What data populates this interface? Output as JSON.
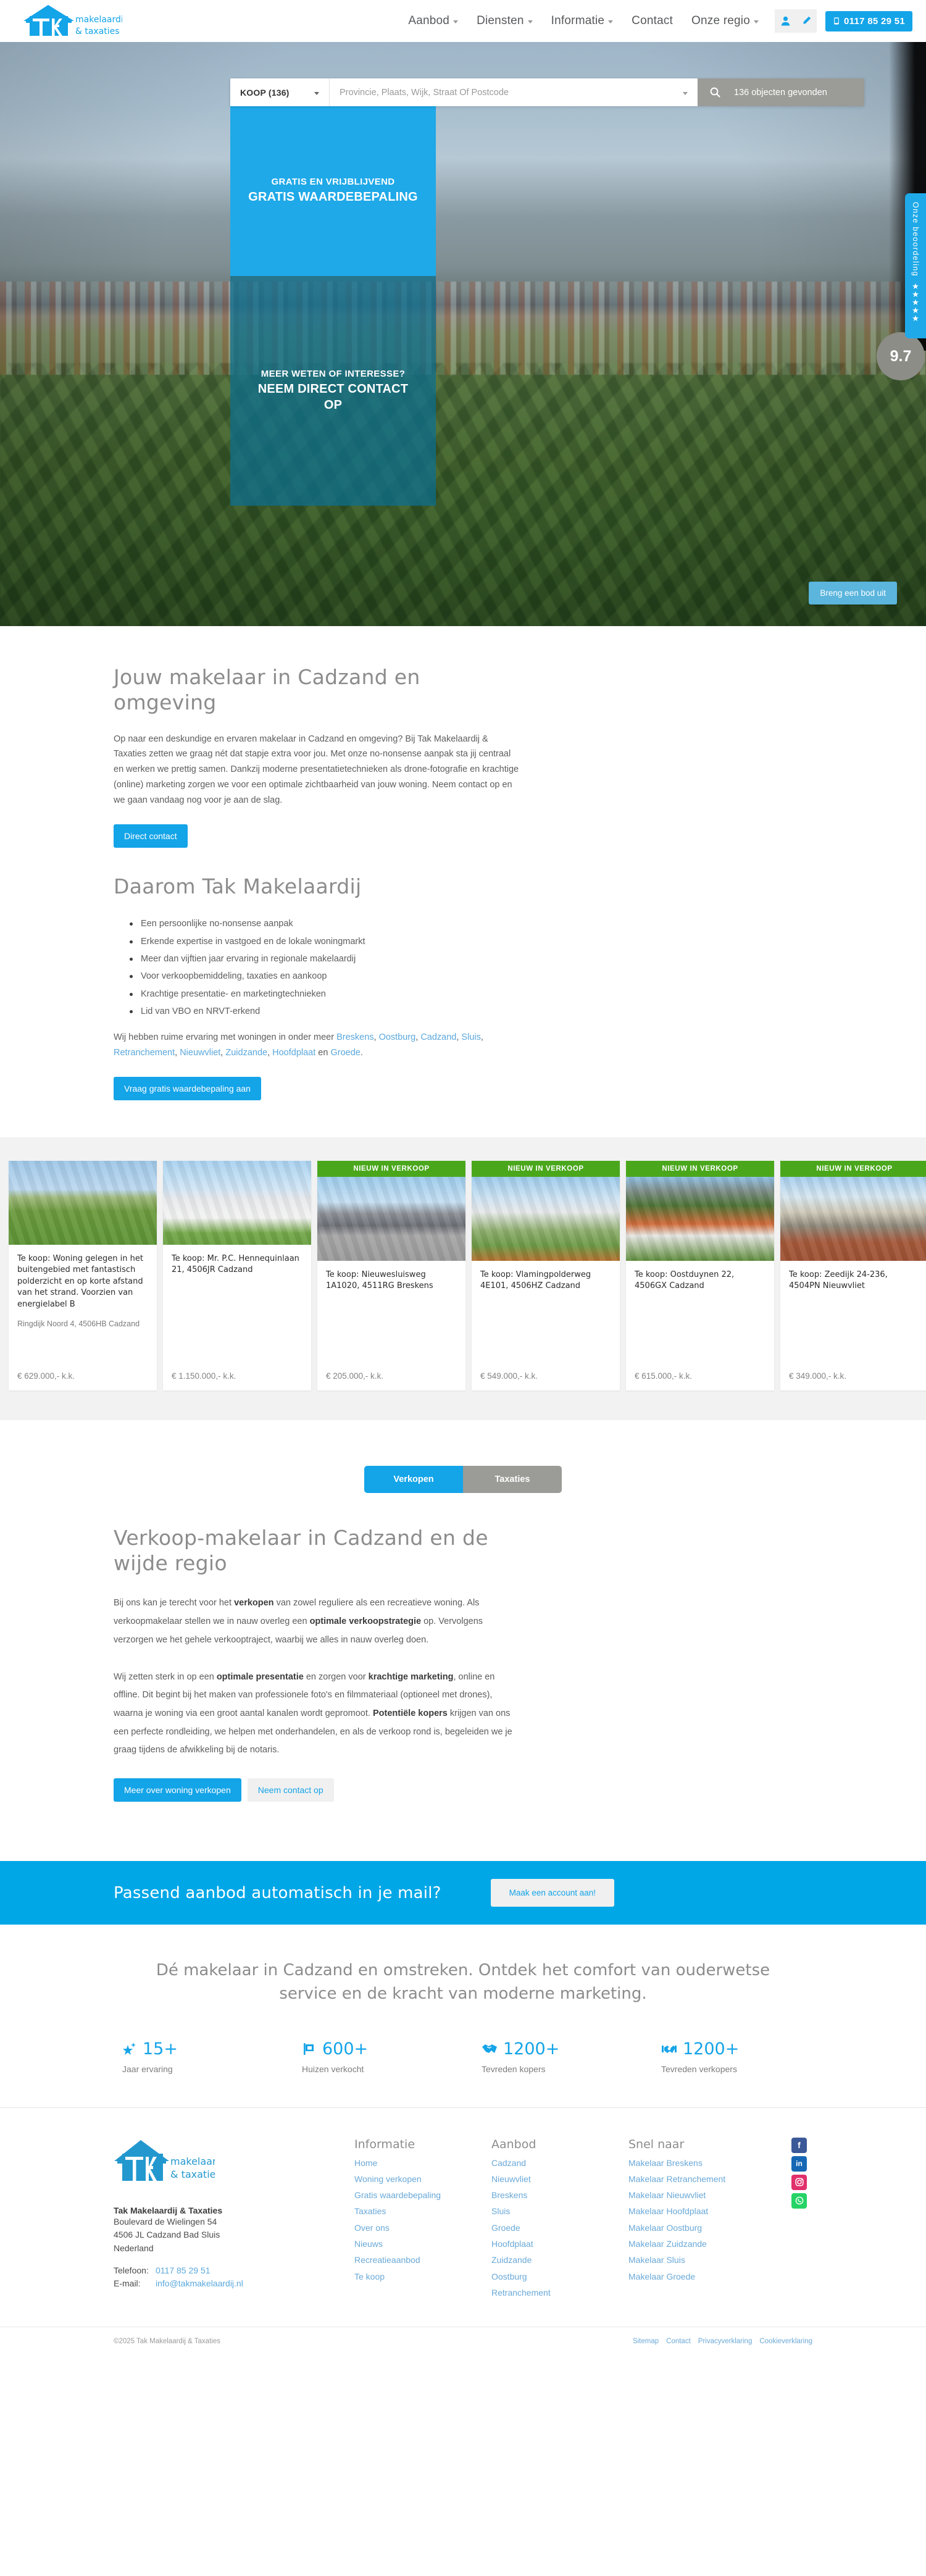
{
  "brand": {
    "name": "TAK",
    "tagline_1": "makelaardij",
    "tagline_2": "& taxaties"
  },
  "header": {
    "nav": [
      {
        "label": "Aanbod",
        "has_dropdown": true
      },
      {
        "label": "Diensten",
        "has_dropdown": true
      },
      {
        "label": "Informatie",
        "has_dropdown": true
      },
      {
        "label": "Contact",
        "has_dropdown": false
      },
      {
        "label": "Onze regio",
        "has_dropdown": true
      }
    ],
    "phone": "0117 85 29 51"
  },
  "hero": {
    "search": {
      "type_label": "KOOP (136)",
      "placeholder": "Provincie, Plaats, Wijk, Straat Of Postcode",
      "value": "",
      "results_text": "136 objecten gevonden"
    },
    "card_top": {
      "eyebrow": "GRATIS EN VRIJBLIJVEND",
      "headline": "GRATIS WAARDEBEPALING"
    },
    "card_bottom": {
      "eyebrow": "MEER WETEN OF INTERESSE?",
      "headline": "NEEM DIRECT CONTACT OP"
    },
    "bid_button": "Breng een bod uit",
    "review": {
      "label": "Onze beoordeling",
      "stars": 5,
      "score": "9.7"
    }
  },
  "intro": {
    "title": "Jouw makelaar in Cadzand en omgeving",
    "paragraph": "Op naar een deskundige en ervaren makelaar in Cadzand en omgeving? Bij Tak Makelaardij & Taxaties zetten we graag nét dat stapje extra voor jou. Met onze no-nonsense aanpak sta jij centraal en werken we prettig samen. Dankzij moderne presentatietechnieken als drone-fotografie en krachtige (online) marketing zorgen we voor een optimale zichtbaarheid van jouw woning. Neem contact op en we gaan vandaag nog voor je aan de slag.",
    "button": "Direct contact"
  },
  "reasons": {
    "title": "Daarom Tak Makelaardij",
    "items": [
      "Een persoonlijke no-nonsense aanpak",
      "Erkende expertise in vastgoed en de lokale woningmarkt",
      "Meer dan vijftien jaar ervaring in regionale makelaardij",
      "Voor verkoopbemiddeling, taxaties en aankoop",
      "Krachtige presentatie- en marketingtechnieken",
      "Lid van VBO en NRVT-erkend"
    ],
    "region_prefix": "Wij hebben ruime ervaring met woningen in onder meer ",
    "regions": [
      "Breskens",
      "Oostburg",
      "Cadzand",
      "Sluis",
      "Retranchement",
      "Nieuwvliet",
      "Zuidzande",
      "Hoofdplaat",
      "Groede"
    ],
    "button": "Vraag gratis waardebepaling aan"
  },
  "listings": {
    "badge_new": "NIEUW IN VERKOOP",
    "cards": [
      {
        "badge": "",
        "title": "Te koop: Woning gelegen in het buitengebied met fantastisch polderzicht en op korte afstand van het strand. Voorzien van energielabel B",
        "address": "Ringdijk Noord 4, 4506HB Cadzand",
        "price": "€ 629.000,- k.k."
      },
      {
        "badge": "",
        "title": "Te koop: Mr. P.C. Hennequinlaan 21, 4506JR Cadzand",
        "address": "",
        "price": "€ 1.150.000,- k.k."
      },
      {
        "badge": "NIEUW IN VERKOOP",
        "title": "Te koop: Nieuwesluisweg 1A1020, 4511RG Breskens",
        "address": "",
        "price": "€ 205.000,- k.k."
      },
      {
        "badge": "NIEUW IN VERKOOP",
        "title": "Te koop: Vlamingpolderweg 4E101, 4506HZ Cadzand",
        "address": "",
        "price": "€ 549.000,- k.k."
      },
      {
        "badge": "NIEUW IN VERKOOP",
        "title": "Te koop: Oostduynen 22, 4506GX Cadzand",
        "address": "",
        "price": "€ 615.000,- k.k."
      },
      {
        "badge": "NIEUW IN VERKOOP",
        "title": "Te koop: Zeedijk 24-236, 4504PN Nieuwvliet",
        "address": "",
        "price": "€ 349.000,- k.k."
      }
    ]
  },
  "tabs": {
    "active": "Verkopen",
    "inactive": "Taxaties"
  },
  "sell": {
    "title": "Verkoop-makelaar in Cadzand en de wijde regio",
    "p1_a": "Bij ons kan je terecht voor het ",
    "p1_b": "verkopen",
    "p1_c": " van zowel reguliere als een recreatieve woning. Als verkoopmakelaar stellen we in nauw overleg een ",
    "p1_d": "optimale verkoopstrategie",
    "p1_e": " op. Vervolgens verzorgen we het gehele verkooptraject, waarbij we alles in nauw overleg doen.",
    "p2_a": "Wij zetten sterk in op een ",
    "p2_b": "optimale presentatie",
    "p2_c": " en zorgen voor ",
    "p2_d": "krachtige marketing",
    "p2_e": ", online en offline. Dit begint bij het maken van professionele foto's en filmmateriaal (optioneel met drones), waarna je woning via een groot aantal kanalen wordt gepromoot. ",
    "p2_f": "Potentiële kopers",
    "p2_g": " krijgen van ons een perfecte rondleiding, we helpen met onderhandelen, en als de verkoop rond is, begeleiden we je graag tijdens de afwikkeling bij de notaris.",
    "btn_primary": "Meer over woning verkopen",
    "btn_secondary": "Neem contact op"
  },
  "cta": {
    "title": "Passend aanbod automatisch in je mail?",
    "button": "Maak een account aan!"
  },
  "stats": {
    "heading": "Dé makelaar in Cadzand en omstreken. Ontdek het comfort van ouderwetse service en de kracht van moderne marketing.",
    "items": [
      {
        "icon": "star-sparkle-icon",
        "value": "15+",
        "label": "Jaar ervaring"
      },
      {
        "icon": "sold-sign-icon",
        "value": "600+",
        "label": "Huizen verkocht"
      },
      {
        "icon": "handshake-icon",
        "value": "1200+",
        "label": "Tevreden kopers"
      },
      {
        "icon": "key-handover-icon",
        "value": "1200+",
        "label": "Tevreden verkopers"
      }
    ]
  },
  "footer": {
    "company": "Tak Makelaardij & Taxaties",
    "address_line1": "Boulevard de Wielingen 54",
    "address_line2": "4506 JL Cadzand Bad Sluis",
    "address_line3": "Nederland",
    "phone_label": "Telefoon:",
    "phone": "0117 85 29 51",
    "email_label": "E-mail:",
    "email": "info@takmakelaardij.nl",
    "columns": [
      {
        "title": "Informatie",
        "links": [
          "Home",
          "Woning verkopen",
          "Gratis waardebepaling",
          "Taxaties",
          "Over ons",
          "Nieuws",
          "Recreatieaanbod",
          "Te koop"
        ]
      },
      {
        "title": "Aanbod",
        "links": [
          "Cadzand",
          "Nieuwvliet",
          "Breskens",
          "Sluis",
          "Groede",
          "Hoofdplaat",
          "Zuidzande",
          "Oostburg",
          "Retranchement"
        ]
      },
      {
        "title": "Snel naar",
        "links": [
          "Makelaar Breskens",
          "Makelaar Retranchement",
          "Makelaar Nieuwvliet",
          "Makelaar Hoofdplaat",
          "Makelaar Oostburg",
          "Makelaar Zuidzande",
          "Makelaar Sluis",
          "Makelaar Groede"
        ]
      }
    ],
    "socials": [
      {
        "name": "facebook-icon",
        "glyph": "f"
      },
      {
        "name": "linkedin-icon",
        "glyph": "in"
      },
      {
        "name": "instagram-icon",
        "glyph": "◉"
      },
      {
        "name": "whatsapp-icon",
        "glyph": "✆"
      }
    ],
    "copyright": "©2025 Tak Makelaardij & Taxaties",
    "bottom_links": [
      "Sitemap",
      "Contact",
      "Privacyverklaring",
      "Cookieverklaring"
    ]
  },
  "colors": {
    "brand_blue": "#14a4e8",
    "hero_blue": "#1fa9e8",
    "badge_green": "#4aa71c",
    "grey": "#9b9b97"
  }
}
